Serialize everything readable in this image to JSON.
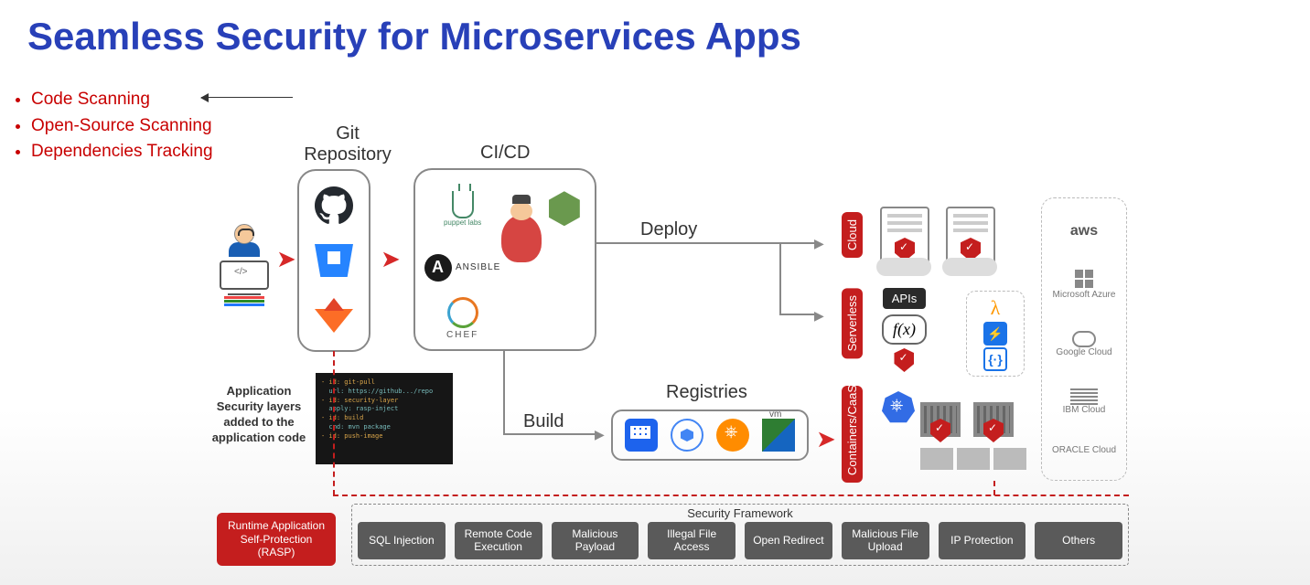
{
  "title": "Seamless Security for Microservices Apps",
  "scanning": [
    "Code Scanning",
    "Open-Source Scanning",
    "Dependencies Tracking"
  ],
  "labels": {
    "git": "Git Repository",
    "cicd": "CI/CD",
    "deploy": "Deploy",
    "build": "Build",
    "registries": "Registries"
  },
  "git_tools": [
    "GitHub",
    "Bitbucket",
    "GitLab"
  ],
  "cicd_tools": {
    "puppet": "puppet labs",
    "ansible": "ANSIBLE",
    "chef": "CHEF"
  },
  "annotation": "Application Security layers added to the application code",
  "vert_tags": {
    "cloud": "Cloud",
    "serverless": "Serverless",
    "containers": "Containers/CaaS"
  },
  "api_label": "APIs",
  "fx_label": "f(x)",
  "cloud_providers": [
    {
      "name": "aws",
      "label": "aws"
    },
    {
      "name": "azure",
      "label": "Microsoft Azure"
    },
    {
      "name": "gcp",
      "label": "Google Cloud"
    },
    {
      "name": "ibm",
      "label": "IBM Cloud"
    },
    {
      "name": "oracle",
      "label": "ORACLE Cloud"
    }
  ],
  "rasp": "Runtime Application Self-Protection (RASP)",
  "security_framework": {
    "title": "Security Framework",
    "items": [
      "SQL Injection",
      "Remote Code Execution",
      "Malicious Payload",
      "Illegal File Access",
      "Open Redirect",
      "Malicious File Upload",
      "IP Protection",
      "Others"
    ]
  }
}
